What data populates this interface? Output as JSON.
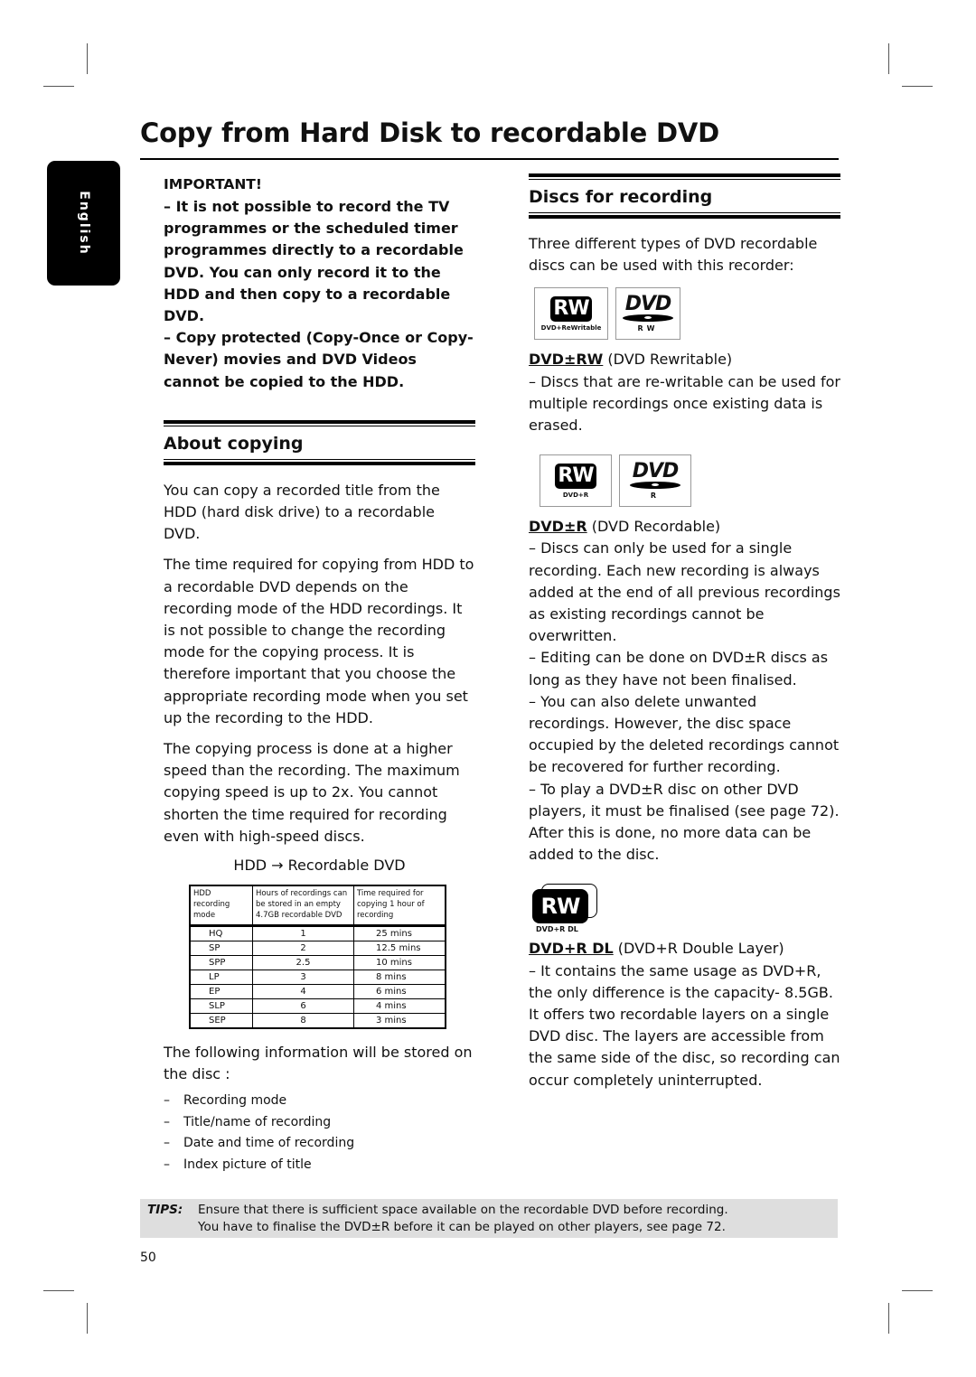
{
  "page": {
    "title": "Copy from Hard Disk to recordable DVD",
    "language_tab": "English",
    "page_number": "50"
  },
  "important": {
    "heading": "IMPORTANT!",
    "items": [
      "– It is not possible to record the TV programmes or the scheduled timer programmes directly to a recordable DVD.  You can only record it to the HDD and then copy to a recordable DVD.",
      "– Copy protected (Copy-Once or Copy-Never) movies and DVD Videos cannot be copied to the HDD."
    ]
  },
  "about_copying": {
    "heading": "About copying",
    "paragraphs": [
      "You can copy a recorded title from the HDD (hard disk drive) to a recordable DVD.",
      "The time required for copying from HDD to a recordable DVD depends on the recording mode of the HDD recordings. It is not possible to change the recording mode for the copying process. It is therefore important that you choose the appropriate recording mode when you set up the recording to the HDD.",
      "The copying process is done at a higher speed than the recording. The maximum copying speed is up to 2x.  You cannot shorten the time required for recording even with high-speed discs."
    ],
    "flow_label": "HDD → Recordable DVD",
    "table": {
      "headers": [
        "HDD recording mode",
        "Hours of recordings can be stored in an empty 4.7GB recordable DVD",
        "Time required for copying 1 hour of recording"
      ],
      "rows": [
        [
          "HQ",
          "1",
          "25 mins"
        ],
        [
          "SP",
          "2",
          "12.5 mins"
        ],
        [
          "SPP",
          "2.5",
          "10 mins"
        ],
        [
          "LP",
          "3",
          "8 mins"
        ],
        [
          "EP",
          "4",
          "6 mins"
        ],
        [
          "SLP",
          "6",
          "4 mins"
        ],
        [
          "SEP",
          "8",
          "3 mins"
        ]
      ]
    },
    "stored_intro": "The following information will be stored on the disc :",
    "stored_items": [
      "Recording mode",
      "Title/name of recording",
      "Date and time of recording",
      "Index picture of title"
    ]
  },
  "discs": {
    "heading": "Discs for recording",
    "intro": "Three different types of DVD recordable discs can be used with this recorder:",
    "types": [
      {
        "logo_rw_label": "RW",
        "logo_rw_sub": "DVD+ReWritable",
        "logo_dvd_label": "DVD",
        "logo_dvd_sub": "RW",
        "keyword": "DVD±RW",
        "name": " (DVD Rewritable)",
        "description": "– Discs that are re-writable can be used for multiple recordings once existing data is erased."
      },
      {
        "logo_rw_label": "RW",
        "logo_rw_sub": "DVD+R",
        "logo_dvd_label": "DVD",
        "logo_dvd_sub": "R",
        "keyword": "DVD±R",
        "name": " (DVD Recordable)",
        "description_lines": [
          "– Discs can only be used for a single recording. Each new recording is always added at the end of all previous recordings as existing recordings cannot be overwritten.",
          "– Editing can be done on DVD±R discs as long as they have not been finalised.",
          "– You can also delete unwanted recordings. However, the disc space occupied by the deleted recordings cannot be recovered for further recording.",
          "– To play a DVD±R disc on other DVD players, it must be finalised (see page 72). After this is done, no more data can be added to the disc."
        ]
      },
      {
        "logo_rw_label": "RW",
        "logo_rw_sub": "DVD+R DL",
        "keyword": "DVD+R DL",
        "name": " (DVD+R Double Layer)",
        "description": "– It contains the same usage as DVD+R, the only difference is the capacity- 8.5GB. It offers two recordable layers on a single DVD disc.  The layers are accessible from the same side of the disc, so recording can occur completely uninterrupted."
      }
    ]
  },
  "tips": {
    "label": "TIPS:",
    "lines": [
      "Ensure that there is sufficient space available on the recordable DVD before recording.",
      "You have to finalise the DVD±R before it can be played on other players, see page 72."
    ]
  }
}
